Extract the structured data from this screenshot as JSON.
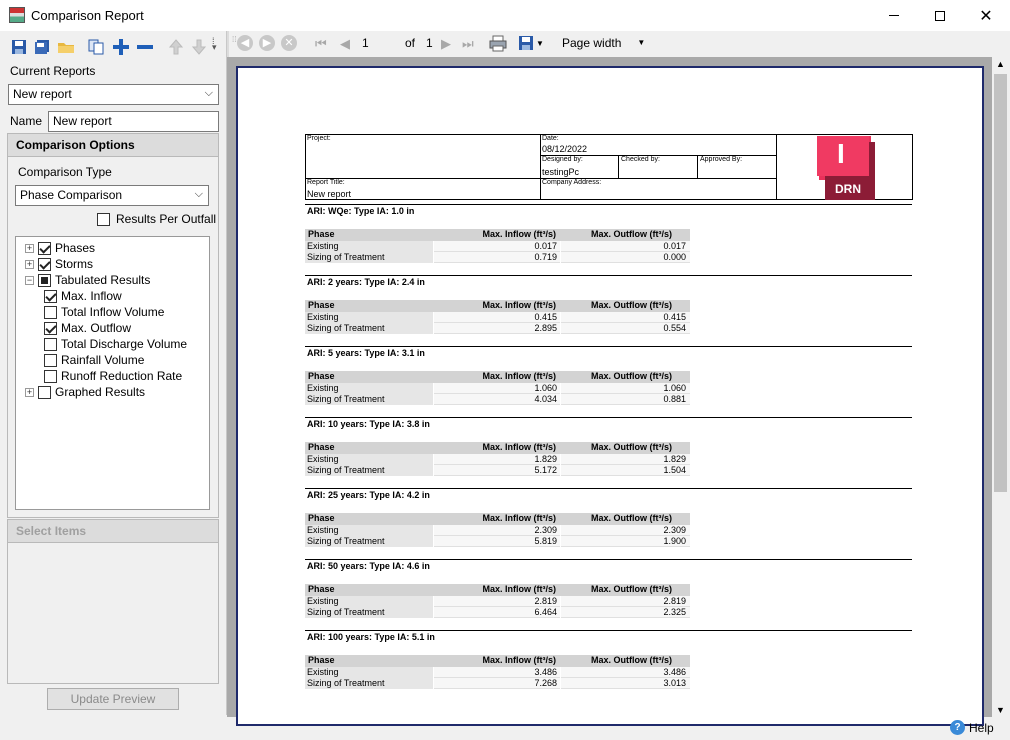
{
  "window": {
    "title": "Comparison Report",
    "minimize_icon": "minimize-icon",
    "maximize_icon": "maximize-icon",
    "close_icon": "close-icon"
  },
  "left": {
    "current_reports_label": "Current Reports",
    "current_report_value": "New report",
    "name_label": "Name",
    "name_value": "New report",
    "comparison_options_header": "Comparison Options",
    "comparison_type_label": "Comparison Type",
    "comparison_type_value": "Phase Comparison",
    "results_per_outfall_label": "Results Per Outfall",
    "tree": [
      {
        "label": "Phases",
        "state": "checked",
        "expander": "+"
      },
      {
        "label": "Storms",
        "state": "checked",
        "expander": "+"
      },
      {
        "label": "Tabulated Results",
        "state": "partial",
        "expander": "−"
      },
      {
        "label": "Max. Inflow",
        "state": "checked"
      },
      {
        "label": "Total Inflow Volume",
        "state": "unchecked"
      },
      {
        "label": "Max. Outflow",
        "state": "checked"
      },
      {
        "label": "Total Discharge Volume",
        "state": "unchecked"
      },
      {
        "label": "Rainfall Volume",
        "state": "unchecked"
      },
      {
        "label": "Runoff Reduction Rate",
        "state": "unchecked"
      },
      {
        "label": "Graphed Results",
        "state": "unchecked",
        "expander": "+"
      }
    ],
    "select_items_header": "Select Items",
    "update_preview_label": "Update Preview"
  },
  "viewer_toolbar": {
    "page_current": "1",
    "of_label": "of",
    "page_total": "1",
    "zoom_value": "Page width"
  },
  "report": {
    "project_label": "Project:",
    "date_label": "Date:",
    "date_value": "08/12/2022",
    "designed_by_label": "Designed by:",
    "designed_by_value": "testingPc",
    "checked_by_label": "Checked by:",
    "approved_by_label": "Approved By:",
    "report_title_label": "Report Title:",
    "report_title_value": "New report",
    "company_address_label": "Company Address:",
    "logo_letter": "I",
    "logo_text": "DRN",
    "col_phase": "Phase",
    "col_inflow": "Max. Inflow (ft³/s)",
    "col_outflow": "Max. Outflow (ft³/s)",
    "sections": [
      {
        "title": "ARI: WQe: Type IA: 1.0 in",
        "rows": [
          [
            "Existing",
            "0.017",
            "0.017"
          ],
          [
            "Sizing of Treatment",
            "0.719",
            "0.000"
          ]
        ]
      },
      {
        "title": "ARI: 2 years: Type IA: 2.4 in",
        "rows": [
          [
            "Existing",
            "0.415",
            "0.415"
          ],
          [
            "Sizing of Treatment",
            "2.895",
            "0.554"
          ]
        ]
      },
      {
        "title": "ARI: 5 years: Type IA: 3.1 in",
        "rows": [
          [
            "Existing",
            "1.060",
            "1.060"
          ],
          [
            "Sizing of Treatment",
            "4.034",
            "0.881"
          ]
        ]
      },
      {
        "title": "ARI: 10 years: Type IA: 3.8 in",
        "rows": [
          [
            "Existing",
            "1.829",
            "1.829"
          ],
          [
            "Sizing of Treatment",
            "5.172",
            "1.504"
          ]
        ]
      },
      {
        "title": "ARI: 25 years: Type IA: 4.2 in",
        "rows": [
          [
            "Existing",
            "2.309",
            "2.309"
          ],
          [
            "Sizing of Treatment",
            "5.819",
            "1.900"
          ]
        ]
      },
      {
        "title": "ARI: 50 years: Type IA: 4.6 in",
        "rows": [
          [
            "Existing",
            "2.819",
            "2.819"
          ],
          [
            "Sizing of Treatment",
            "6.464",
            "2.325"
          ]
        ]
      },
      {
        "title": "ARI: 100 years: Type IA: 5.1 in",
        "rows": [
          [
            "Existing",
            "3.486",
            "3.486"
          ],
          [
            "Sizing of Treatment",
            "7.268",
            "3.013"
          ]
        ]
      }
    ]
  },
  "status": {
    "help_label": "Help"
  }
}
